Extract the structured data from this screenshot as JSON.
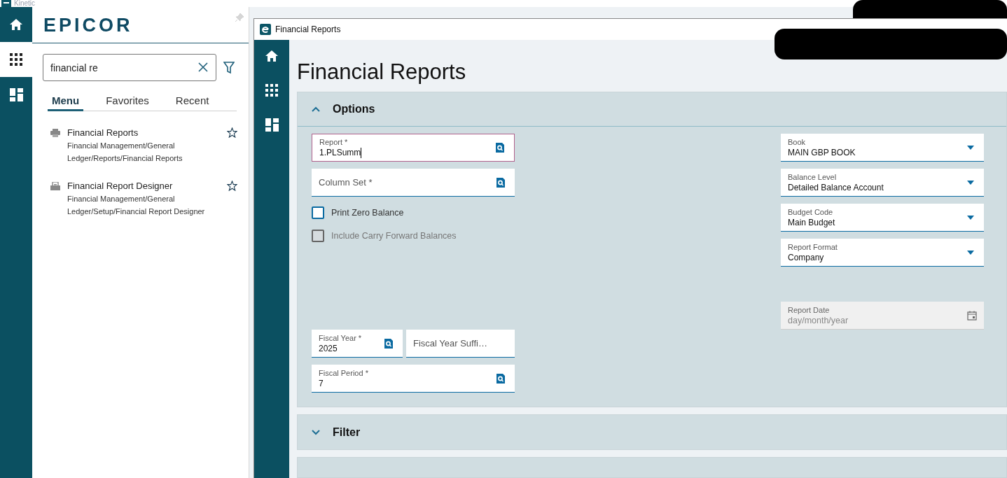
{
  "window": {
    "title": "Kinetic"
  },
  "rail": [
    {
      "kind": "home",
      "selected": false
    },
    {
      "kind": "apps",
      "selected": true
    },
    {
      "kind": "dashboard",
      "selected": false
    }
  ],
  "menu_panel": {
    "logo": "EPICOR",
    "search": {
      "value": "financial re"
    },
    "tabs": [
      {
        "label": "Menu",
        "selected": true
      },
      {
        "label": "Favorites",
        "selected": false
      },
      {
        "label": "Recent",
        "selected": false
      }
    ],
    "items": [
      {
        "kind": "report",
        "title": "Financial Reports",
        "path": "Financial Management/General Ledger/Reports/Financial Reports",
        "favorite": false
      },
      {
        "kind": "designer",
        "title": "Financial Report Designer",
        "path": "Financial Management/General Ledger/Setup/Financial Report Designer",
        "favorite": false
      }
    ]
  },
  "app_window": {
    "title": "Financial Reports",
    "rail": [
      {
        "kind": "home"
      },
      {
        "kind": "apps"
      },
      {
        "kind": "dashboard"
      }
    ],
    "page_title": "Financial Reports",
    "panels": [
      {
        "title": "Options",
        "expanded": true
      },
      {
        "title": "Filter",
        "expanded": false
      }
    ],
    "options": {
      "report": {
        "label": "Report *",
        "value": "1.PLSumm",
        "focused": true
      },
      "column_set": {
        "label": "Column Set *"
      },
      "checkboxes": [
        {
          "label": "Print Zero Balance",
          "checked": false,
          "disabled": false
        },
        {
          "label": "Include Carry Forward Balances",
          "checked": false,
          "disabled": true
        }
      ],
      "fiscal_year": {
        "label": "Fiscal Year *",
        "value": "2025"
      },
      "fiscal_year_suffix": {
        "label": "Fiscal Year Suffi…"
      },
      "fiscal_period": {
        "label": "Fiscal Period *",
        "value": "7"
      },
      "dropdowns": [
        {
          "label": "Book",
          "value": "MAIN GBP BOOK"
        },
        {
          "label": "Balance Level",
          "value": "Detailed Balance Account"
        },
        {
          "label": "Budget Code",
          "value": "Main Budget"
        },
        {
          "label": "Report Format",
          "value": "Company"
        }
      ],
      "report_date": {
        "label": "Report Date",
        "placeholder": "day/month/year",
        "disabled": true
      }
    }
  }
}
